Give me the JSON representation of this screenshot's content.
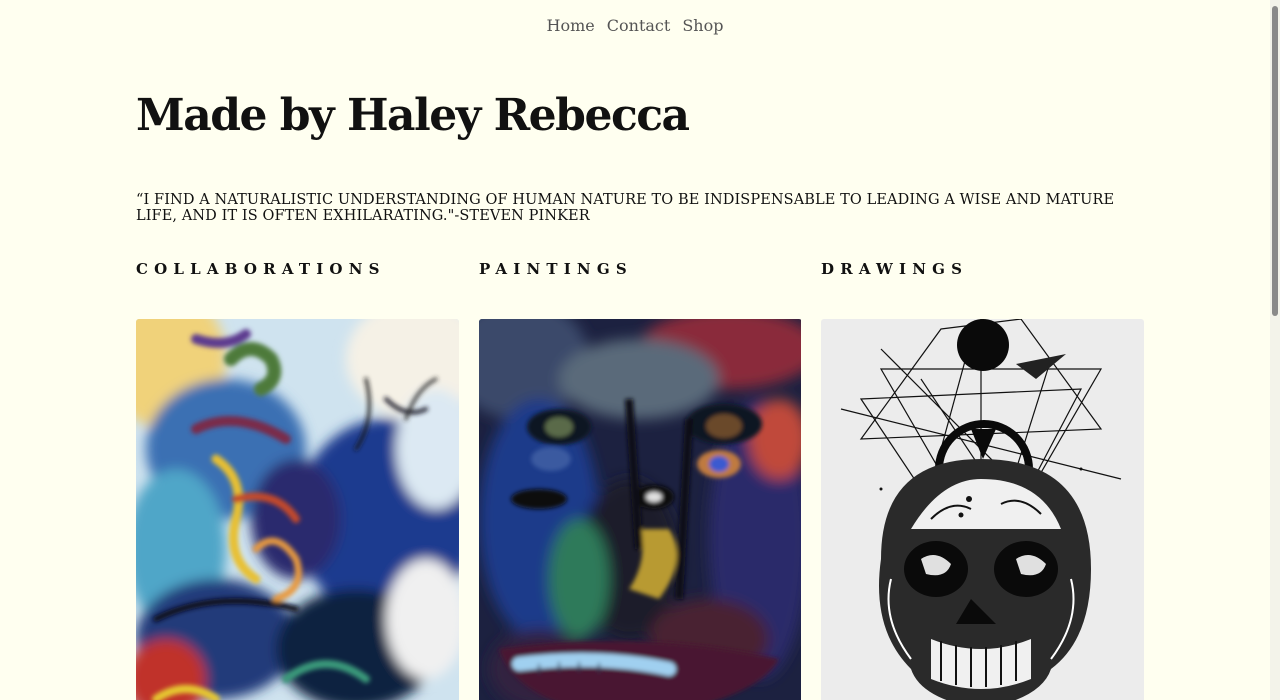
{
  "nav": {
    "home": "Home",
    "contact": "Contact",
    "shop": "Shop"
  },
  "page": {
    "title": "Made by Haley Rebecca",
    "quote": "“I FIND A NATURALISTIC UNDERSTANDING OF HUMAN NATURE TO BE INDISPENSABLE TO LEADING A WISE AND MATURE LIFE, AND IT IS OFTEN EXHILARATING.\"-STEVEN PINKER"
  },
  "sections": [
    {
      "label": "COLLABORATIONS",
      "image": "abstract-painting"
    },
    {
      "label": "PAINTINGS",
      "image": "face-painting"
    },
    {
      "label": "DRAWINGS",
      "image": "skull-drawing"
    }
  ],
  "colors": {
    "background": "#fffff0",
    "text": "#111111",
    "nav_text": "#555555"
  }
}
